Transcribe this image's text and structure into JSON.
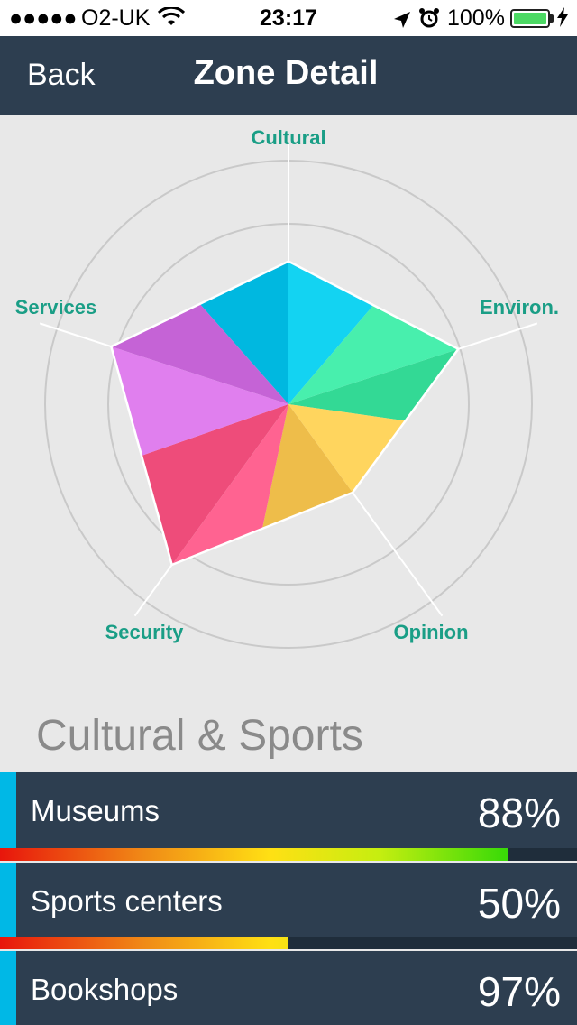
{
  "status_bar": {
    "signal": "●●●●●",
    "carrier": "O2-UK",
    "time": "23:17",
    "battery_pct": "100%",
    "wifi_icon": "wifi-icon",
    "location_icon": "location-arrow-icon",
    "alarm_icon": "alarm-clock-icon",
    "battery_icon": "battery-full-icon",
    "charging_icon": "charging-bolt-icon"
  },
  "nav": {
    "back_label": "Back",
    "title": "Zone Detail"
  },
  "chart_data": {
    "type": "radar",
    "axes": [
      "Cultural",
      "Environ.",
      "Opinion",
      "Security",
      "Services"
    ],
    "values": [
      0.72,
      0.9,
      0.55,
      1.0,
      0.94
    ],
    "grid": "concentric circles",
    "colors": {
      "cultural": [
        "#13d3f2",
        "#00b8e0"
      ],
      "environ": [
        "#33d995",
        "#48efad"
      ],
      "opinion": [
        "#eebd4a",
        "#ffd55e"
      ],
      "security": [
        "#ee4c7a",
        "#ff6391"
      ],
      "services": [
        "#c563d6",
        "#e07fee"
      ]
    }
  },
  "section": {
    "title": "Cultural & Sports"
  },
  "items": [
    {
      "label": "Museums",
      "percent": "88%",
      "value": 0.88
    },
    {
      "label": "Sports centers",
      "percent": "50%",
      "value": 0.5
    },
    {
      "label": "Bookshops",
      "percent": "97%",
      "value": 0.97
    }
  ],
  "colors": {
    "nav_background": "#2d3e50",
    "accent": "#00b8e6",
    "axis_label": "#1a9e86"
  }
}
